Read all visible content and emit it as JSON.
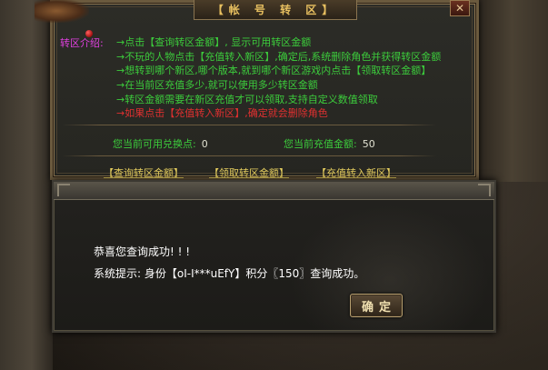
{
  "window": {
    "title": "【帐 号 转 区】",
    "close_glyph": "✕"
  },
  "intro": {
    "label": "转区介绍:",
    "lines": [
      "→点击【查询转区金额】, 显示可用转区金额",
      "→不玩的人物点击【充值转入新区】,确定后,系统删除角色并获得转区金额",
      "→想转到哪个新区,哪个版本,就到哪个新区游戏内点击【领取转区金额】",
      "→在当前区充值多少,就可以使用多少转区金额",
      "→转区金额需要在新区充值才可以领取,支持自定义数值领取",
      "→如果点击【充值转入新区】,确定就会删除角色"
    ]
  },
  "stats": {
    "points_label": "您当前可用兑换点:",
    "points_value": "0",
    "recharge_label": "您当前充值金额:",
    "recharge_value": "50"
  },
  "actions": {
    "query": "【查询转区金额】",
    "claim": "【领取转区金额】",
    "transfer": "【充值转入新区】"
  },
  "dialog": {
    "line1": "恭喜您查询成功! ! !",
    "line2": "系统提示: 身份【oI-I***uEfY】积分〖150〗查询成功。",
    "confirm_label": "确定"
  },
  "colors": {
    "intro_green": "#3ccc3c",
    "warning_red": "#e03030",
    "label_magenta": "#e040e0",
    "link_yellow": "#e8d060",
    "title_gold": "#e8c060"
  }
}
